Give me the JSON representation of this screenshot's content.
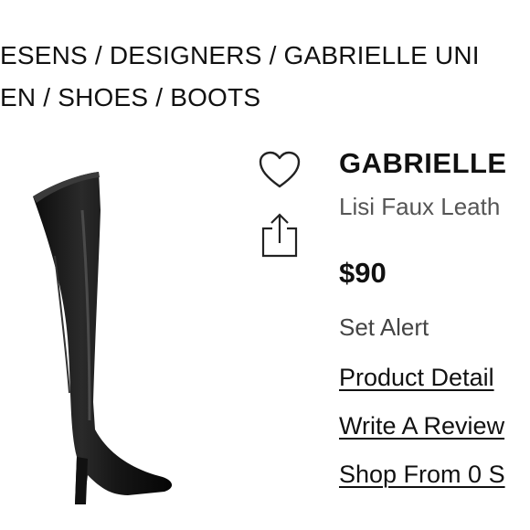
{
  "breadcrumb": {
    "line1": "ESENS / DESIGNERS / GABRIELLE UNI",
    "line2": "EN / SHOES / BOOTS"
  },
  "product": {
    "brand": "GABRIELLE",
    "name": "Lisi Faux Leath",
    "price": "$90",
    "set_alert": "Set Alert",
    "image": "black-over-the-knee-boot"
  },
  "actions": {
    "favorite_icon": "heart-icon",
    "share_icon": "share-icon"
  },
  "links": {
    "product_details": "Product Detail",
    "write_review": "Write A Review",
    "shop_from": "Shop From 0 S"
  },
  "colors": {
    "text": "#111111",
    "muted": "#555555",
    "background": "#ffffff"
  }
}
